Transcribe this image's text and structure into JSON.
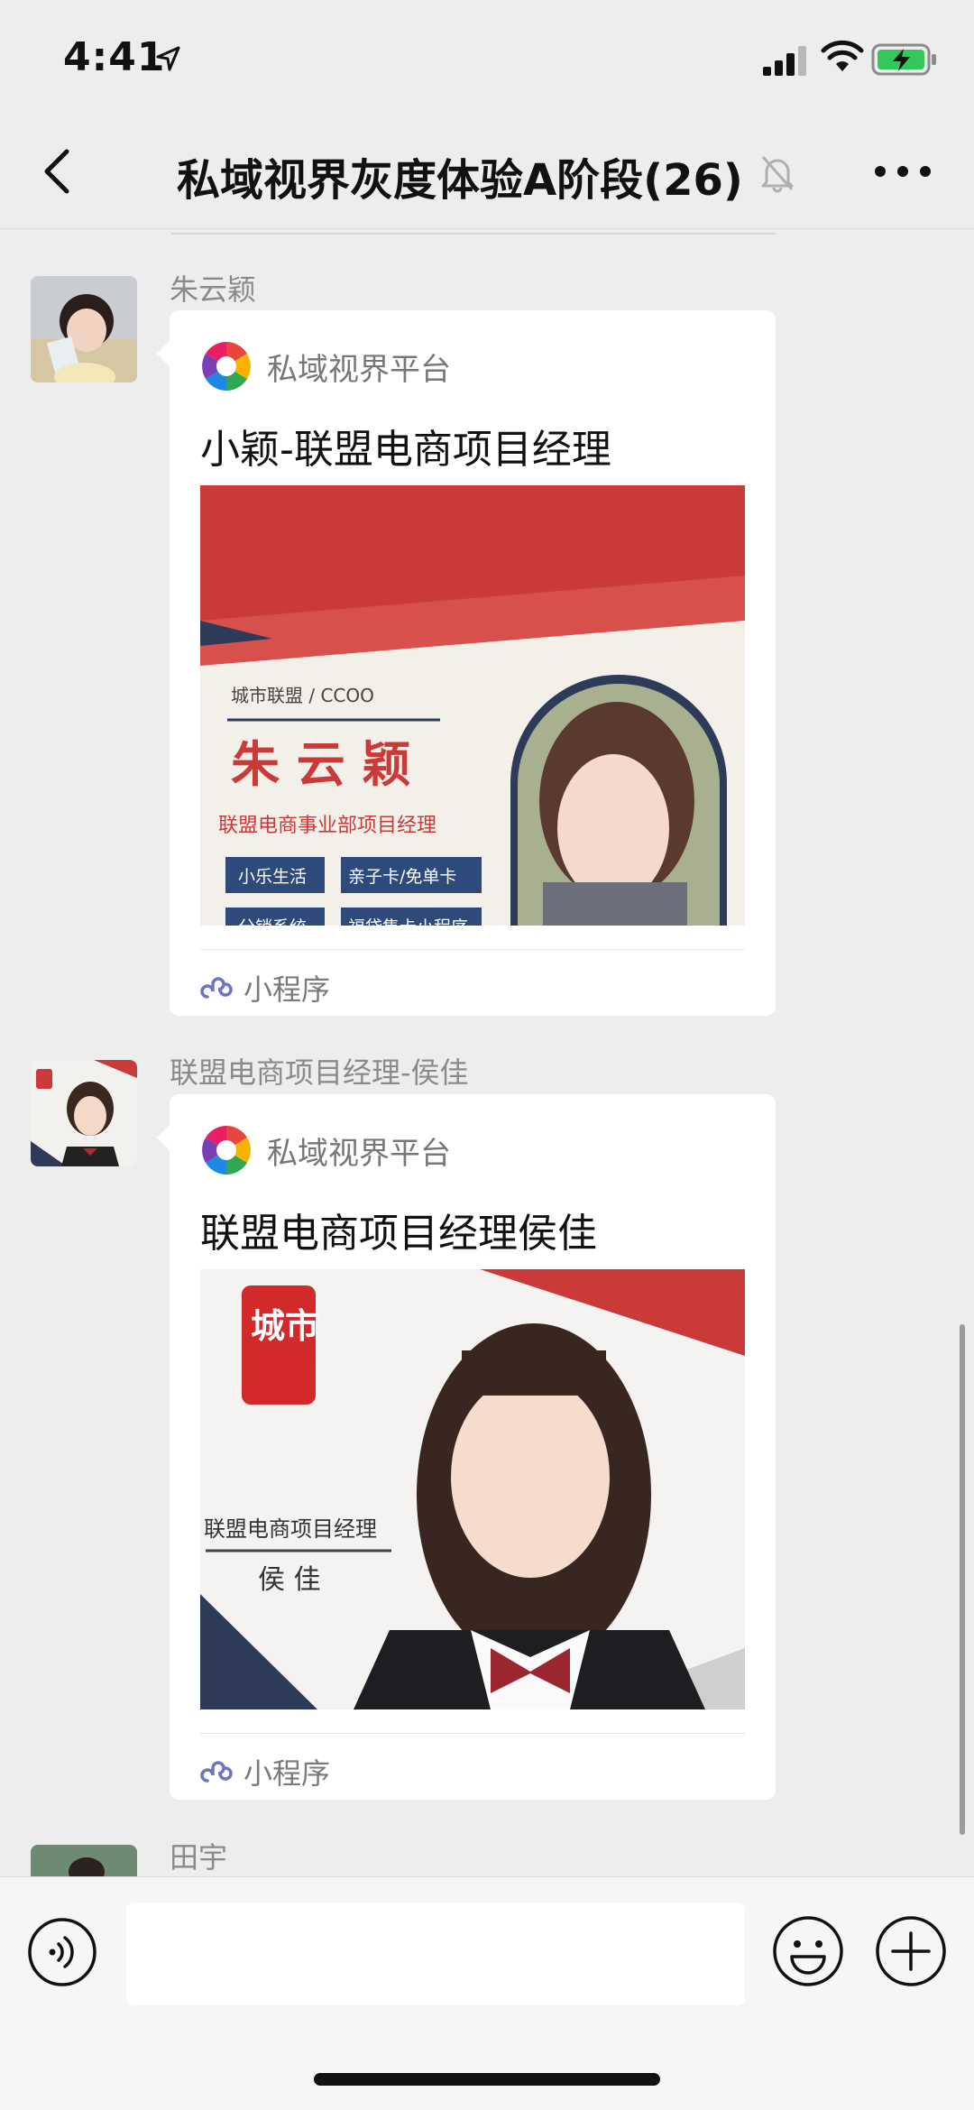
{
  "status_bar": {
    "time": "4:41"
  },
  "nav": {
    "title": "私域视界灰度体验A阶段(26)"
  },
  "messages": [
    {
      "sender": "朱云颖",
      "card": {
        "source": "私域视界平台",
        "title": "小颖-联盟电商项目经理",
        "image_text": {
          "org": "城市联盟 / CCOO",
          "name": "朱 云 颖",
          "role": "联盟电商事业部项目经理",
          "tag1": "小乐生活",
          "tag2": "亲子卡/免单卡",
          "tag3": "分销系统",
          "tag4": "福袋售卡小程序"
        },
        "mini_label": "小程序"
      }
    },
    {
      "sender": "联盟电商项目经理-侯佳",
      "card": {
        "source": "私域视界平台",
        "title": "联盟电商项目经理侯佳",
        "image_text": {
          "seal": "城市",
          "role": "联盟电商项目经理",
          "name": "侯 佳"
        },
        "mini_label": "小程序"
      }
    },
    {
      "sender": "田宇"
    }
  ],
  "colors": {
    "brand_red": "#d4403f",
    "navy": "#2d3a58",
    "background": "#ededed"
  },
  "icons": [
    "location-arrow-icon",
    "signal-icon",
    "wifi-icon",
    "battery-charging-icon",
    "back-chevron-icon",
    "mute-bell-icon",
    "more-dots-icon",
    "mini-program-icon",
    "voice-icon",
    "emoji-icon",
    "plus-icon"
  ]
}
